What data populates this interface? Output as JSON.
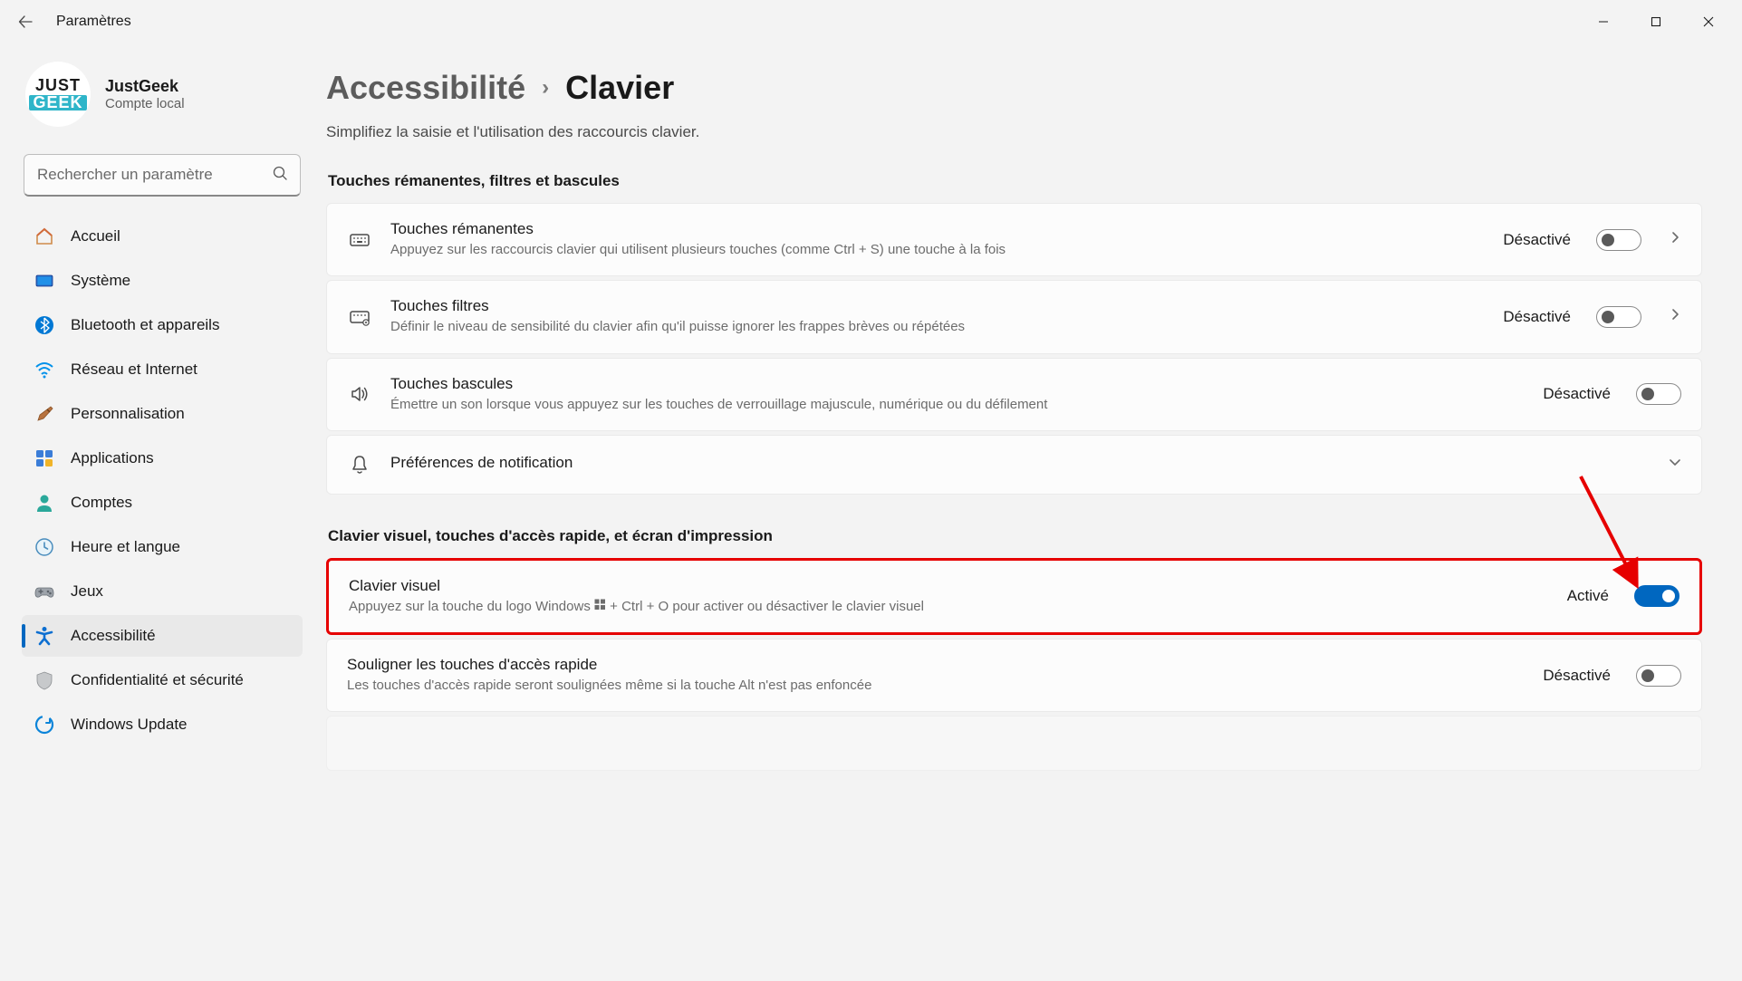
{
  "app": {
    "title": "Paramètres"
  },
  "profile": {
    "name": "JustGeek",
    "account_type": "Compte local",
    "avatar_top": "JUST",
    "avatar_bottom": "GEEK"
  },
  "search": {
    "placeholder": "Rechercher un paramètre"
  },
  "nav": {
    "items": [
      {
        "id": "home",
        "label": "Accueil"
      },
      {
        "id": "system",
        "label": "Système"
      },
      {
        "id": "bluetooth",
        "label": "Bluetooth et appareils"
      },
      {
        "id": "network",
        "label": "Réseau et Internet"
      },
      {
        "id": "personalization",
        "label": "Personnalisation"
      },
      {
        "id": "apps",
        "label": "Applications"
      },
      {
        "id": "accounts",
        "label": "Comptes"
      },
      {
        "id": "time",
        "label": "Heure et langue"
      },
      {
        "id": "gaming",
        "label": "Jeux"
      },
      {
        "id": "accessibility",
        "label": "Accessibilité"
      },
      {
        "id": "privacy",
        "label": "Confidentialité et sécurité"
      },
      {
        "id": "update",
        "label": "Windows Update"
      }
    ]
  },
  "breadcrumb": {
    "parent": "Accessibilité",
    "current": "Clavier"
  },
  "page": {
    "description": "Simplifiez la saisie et l'utilisation des raccourcis clavier."
  },
  "sections": [
    {
      "heading": "Touches rémanentes, filtres et bascules",
      "items": [
        {
          "id": "sticky",
          "title": "Touches rémanentes",
          "desc": "Appuyez sur les raccourcis clavier qui utilisent plusieurs touches (comme Ctrl + S) une touche à la fois",
          "state_label": "Désactivé",
          "on": false,
          "expandable": true
        },
        {
          "id": "filter",
          "title": "Touches filtres",
          "desc": "Définir le niveau de sensibilité du clavier afin qu'il puisse ignorer les frappes brèves ou répétées",
          "state_label": "Désactivé",
          "on": false,
          "expandable": true
        },
        {
          "id": "toggle-keys",
          "title": "Touches bascules",
          "desc": "Émettre un son lorsque vous appuyez sur les touches de verrouillage majuscule, numérique ou du défilement",
          "state_label": "Désactivé",
          "on": false,
          "expandable": false
        },
        {
          "id": "notif",
          "title": "Préférences de notification",
          "desc": "",
          "state_label": "",
          "on": null,
          "expandable": "down"
        }
      ]
    },
    {
      "heading": "Clavier visuel, touches d'accès rapide, et écran d'impression",
      "items": [
        {
          "id": "osk",
          "title": "Clavier visuel",
          "desc_pre": "Appuyez sur la touche du logo Windows ",
          "desc_post": " + Ctrl + O pour activer ou désactiver le clavier visuel",
          "state_label": "Activé",
          "on": true,
          "highlighted": true
        },
        {
          "id": "underline",
          "title": "Souligner les touches d'accès rapide",
          "desc": "Les touches d'accès rapide seront soulignées même si la touche Alt n'est pas enfoncée",
          "state_label": "Désactivé",
          "on": false
        }
      ]
    }
  ]
}
